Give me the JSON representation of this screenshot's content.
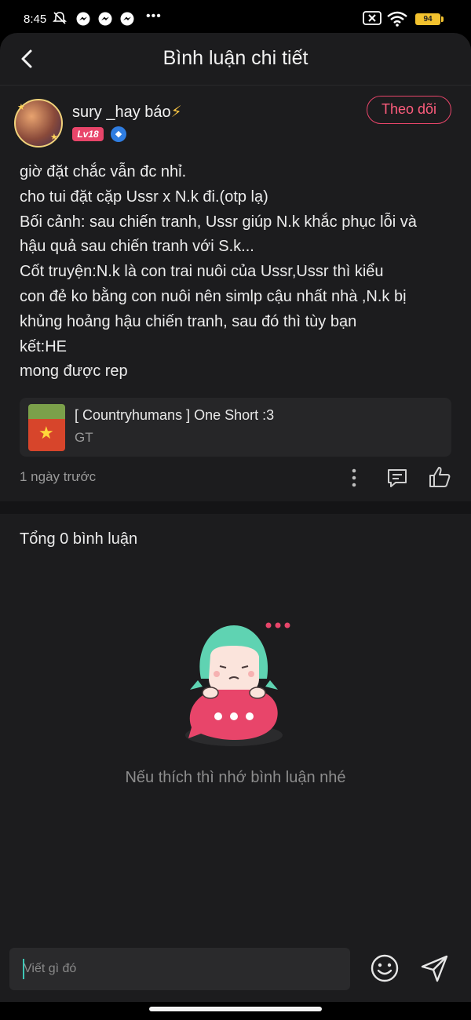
{
  "status_bar": {
    "time": "8:45",
    "dots": "•••",
    "battery": "94",
    "icons": [
      "mute-icon",
      "messenger-icon",
      "messenger-icon",
      "messenger-icon",
      "close-box-icon",
      "wifi-icon",
      "battery-icon"
    ]
  },
  "header": {
    "title": "Bình luận chi tiết",
    "back_icon": "chevron-left-icon"
  },
  "author": {
    "username": "sury _hay báo",
    "emoji": "⚡",
    "level": "Lv18",
    "follow_label": "Theo dõi"
  },
  "post": {
    "lines": [
      "giờ  đặt chắc vẫn đc nhỉ.",
      "cho tui đặt cặp Ussr x N.k đi.(otp lạ)",
      "Bối cảnh: sau chiến tranh, Ussr giúp N.k khắc phục lỗi và",
      "hậu quả sau chiến tranh với S.k...",
      "Cốt truyện:N.k là con trai nuôi của Ussr,Ussr thì kiểu",
      "con đẻ ko bằng con nuôi nên simlp cậu nhất nhà ,N.k bị",
      "khủng hoảng hậu chiến tranh, sau đó thì tùy bạn",
      "kết:HE",
      "mong được rep"
    ],
    "story": {
      "title": "[ Countryhumans ] One Short :3",
      "subtitle": "GT"
    },
    "timestamp": "1 ngày trước"
  },
  "comments": {
    "total_label": "Tổng 0 bình luận",
    "empty_message": "Nếu thích thì nhớ bình luận nhé"
  },
  "composer": {
    "placeholder": "Viết gì đó",
    "value": ""
  },
  "colors": {
    "background": "#1c1c1e",
    "accent": "#e8456a",
    "caret": "#3ec7b6"
  }
}
